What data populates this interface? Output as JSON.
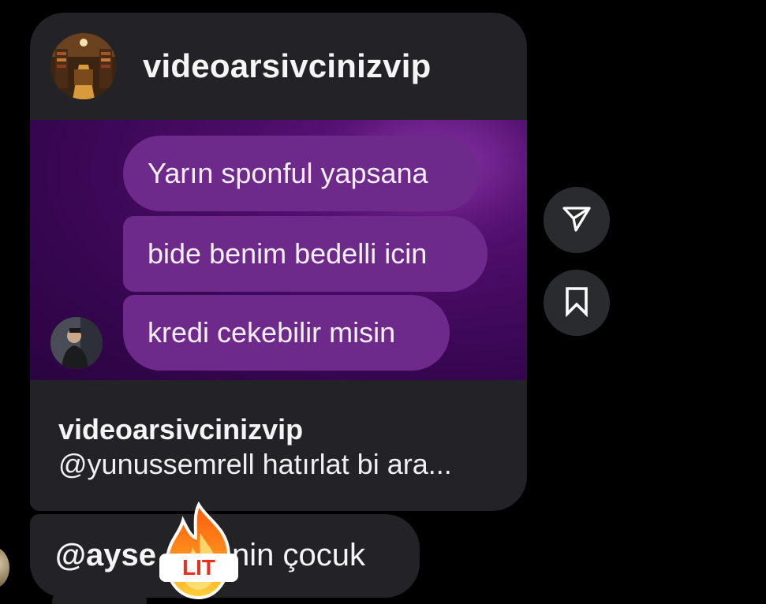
{
  "post": {
    "header_username": "videoarsivcinizvip",
    "media": {
      "bubbles": [
        "Yarın sponful yapsana",
        "bide benim bedelli icin",
        "kredi cekebilir misin"
      ]
    },
    "caption_username": "videoarsivcinizvip",
    "caption_text": "@yunussemrell hatırlat bi ara..."
  },
  "actions": {
    "share_icon": "send-icon",
    "save_icon": "bookmark-icon"
  },
  "reply": {
    "mention": "@ayse",
    "text": "nin çocuk",
    "sticker_label": "LIT",
    "sticker_icon": "fire-lit-sticker"
  },
  "colors": {
    "background": "#000000",
    "card": "#232327",
    "bubble": "#6e2a8a",
    "media_bg": "#3a0654"
  }
}
